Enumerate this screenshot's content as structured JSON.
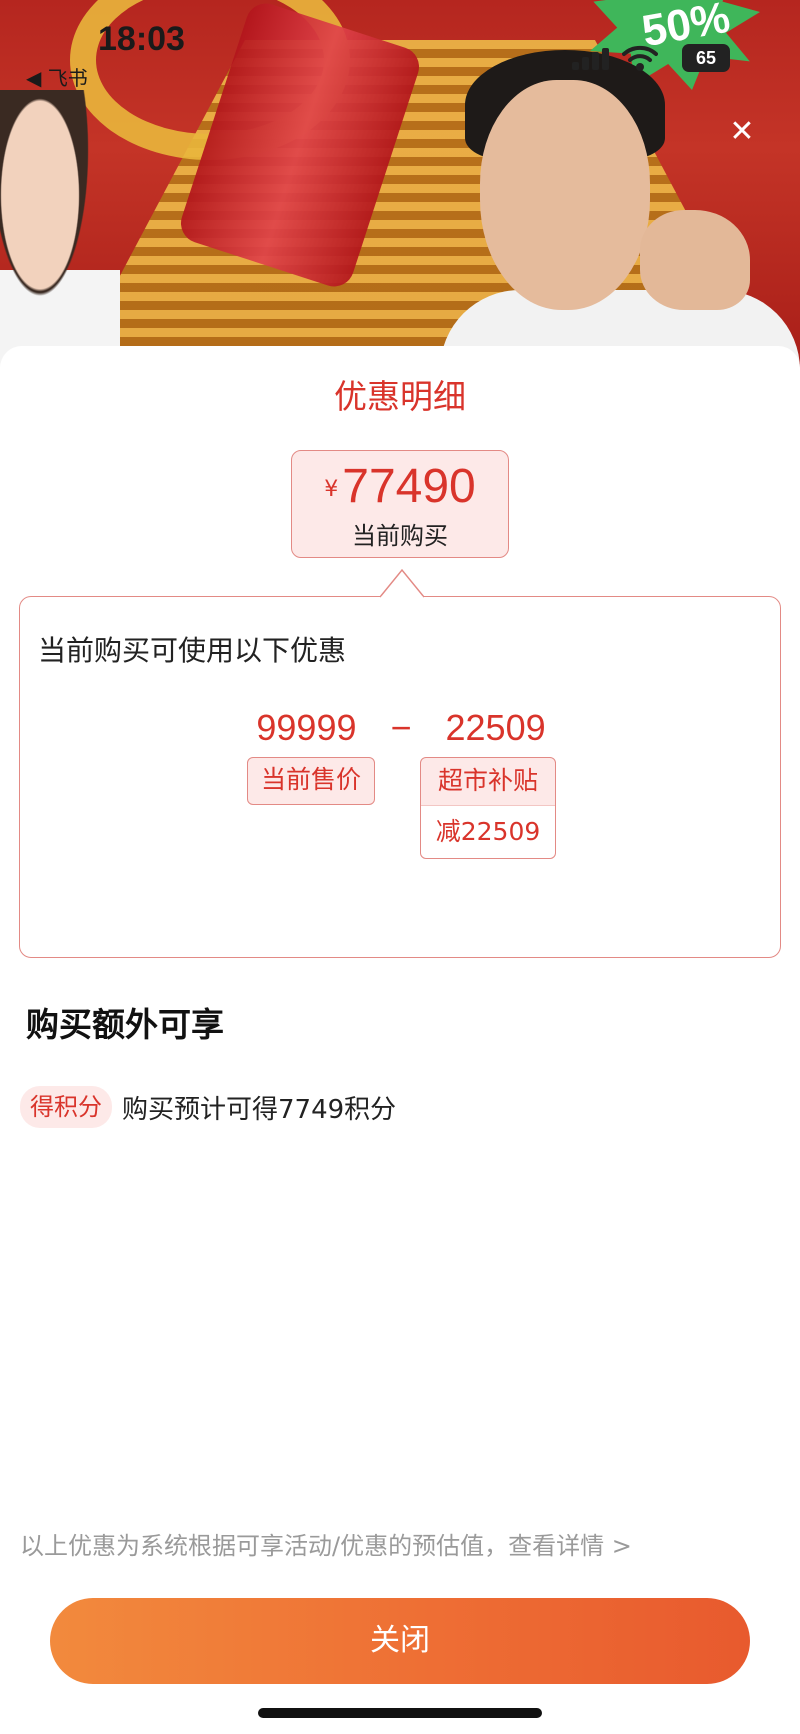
{
  "status_bar": {
    "time": "18:03",
    "back_app": "◀ 飞书",
    "battery": "65"
  },
  "stream": {
    "promo_text": "50%"
  },
  "sheet": {
    "title": "优惠明细",
    "price": {
      "currency": "¥",
      "value": "77490",
      "label": "当前购买"
    },
    "detail": {
      "heading": "当前购买可使用以下优惠",
      "original": "99999",
      "operator": "−",
      "discount": "22509",
      "price_tag": "当前售价",
      "subsidy_tag_title": "超市补贴",
      "subsidy_tag_value": "减22509"
    },
    "extra": {
      "title": "购买额外可享",
      "badge": "得积分",
      "text": "购买预计可得7749积分"
    },
    "disclaimer": "以上优惠为系统根据可享活动/优惠的预估值，查看详情 >",
    "close_button": "关闭"
  },
  "colors": {
    "accent_red": "#d9342b",
    "button_orange": "#ee6e34"
  }
}
